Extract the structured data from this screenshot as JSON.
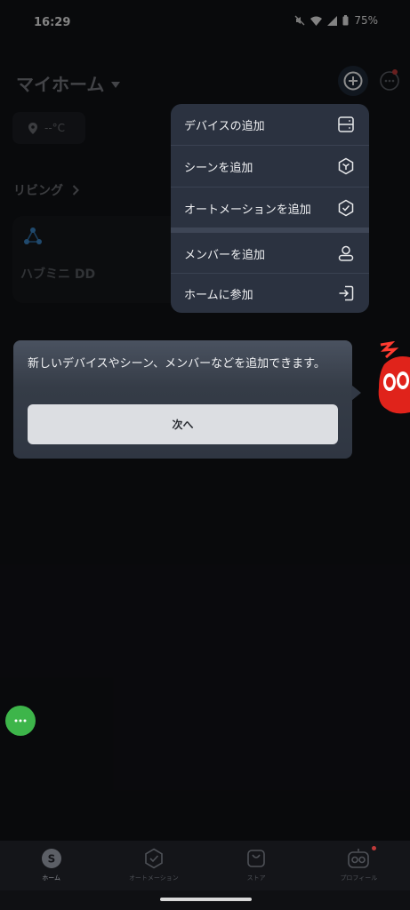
{
  "status_bar": {
    "time": "16:29",
    "battery": "75%"
  },
  "header": {
    "title": "マイホーム"
  },
  "weather": {
    "text": "--°C"
  },
  "room": {
    "name": "リビング"
  },
  "device": {
    "name": "ハブミニ DD"
  },
  "menu": {
    "items": [
      {
        "label": "デバイスの追加",
        "icon": "device-panel-icon"
      },
      {
        "label": "シーンを追加",
        "icon": "scene-cube-icon"
      },
      {
        "label": "オートメーションを追加",
        "icon": "automation-shield-icon"
      },
      {
        "label": "メンバーを追加",
        "icon": "person-icon"
      },
      {
        "label": "ホームに参加",
        "icon": "enter-door-icon"
      }
    ]
  },
  "tooltip": {
    "text": "新しいデバイスやシーン、メンバーなどを追加できます。",
    "button_label": "次へ"
  },
  "bottom_nav": {
    "items": [
      {
        "label": "ホーム",
        "icon": "home-s-icon",
        "active": true
      },
      {
        "label": "オートメーション",
        "icon": "automation-icon",
        "active": false
      },
      {
        "label": "ストア",
        "icon": "store-bag-icon",
        "active": false
      },
      {
        "label": "プロフィール",
        "icon": "profile-robot-icon",
        "active": false
      }
    ]
  },
  "colors": {
    "accent_green": "#3db54a",
    "badge_red": "#c03a3a",
    "menu_bg": "#2b3240"
  }
}
